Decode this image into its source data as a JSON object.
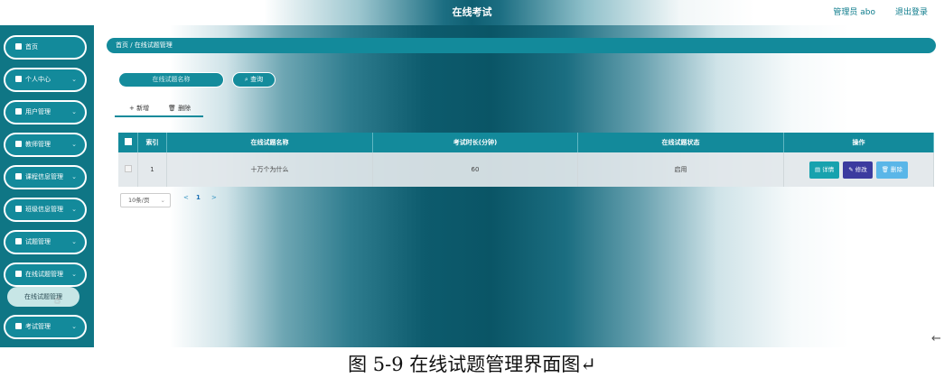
{
  "header": {
    "title": "在线考试",
    "user_label": "管理员 abo",
    "logout_label": "退出登录"
  },
  "sidebar": {
    "items": [
      {
        "label": "首页"
      },
      {
        "label": "个人中心"
      },
      {
        "label": "用户管理"
      },
      {
        "label": "教师管理"
      },
      {
        "label": "课程信息管理"
      },
      {
        "label": "班级信息管理"
      },
      {
        "label": "试题管理"
      },
      {
        "label": "在线试题管理"
      },
      {
        "label": "考试管理"
      }
    ],
    "submenu_item": "在线试题管理"
  },
  "breadcrumb": {
    "text": "首页 / 在线试题管理"
  },
  "search": {
    "placeholder": "在线试题名称",
    "button_label": "查询"
  },
  "actions": {
    "add_label": "+ 新增",
    "delete_label": "删除"
  },
  "table": {
    "columns": [
      "索引",
      "在线试题名称",
      "考试时长(分钟)",
      "在线试题状态",
      "操作"
    ],
    "rows": [
      {
        "index": "1",
        "name": "十万个为什么",
        "duration": "60",
        "status": "启用"
      }
    ],
    "row_actions": {
      "detail": "详情",
      "edit": "修改",
      "delete": "删除"
    }
  },
  "pagination": {
    "page_size": "10条/页",
    "prev": "<",
    "current": "1",
    "next": ">"
  },
  "caption": "图 5-9 在线试题管理界面图↵",
  "colors": {
    "accent": "#138a9b",
    "sidebar": "#0f7685",
    "edit_button": "#3c3b9f",
    "delete_button": "#5ab6e8"
  }
}
